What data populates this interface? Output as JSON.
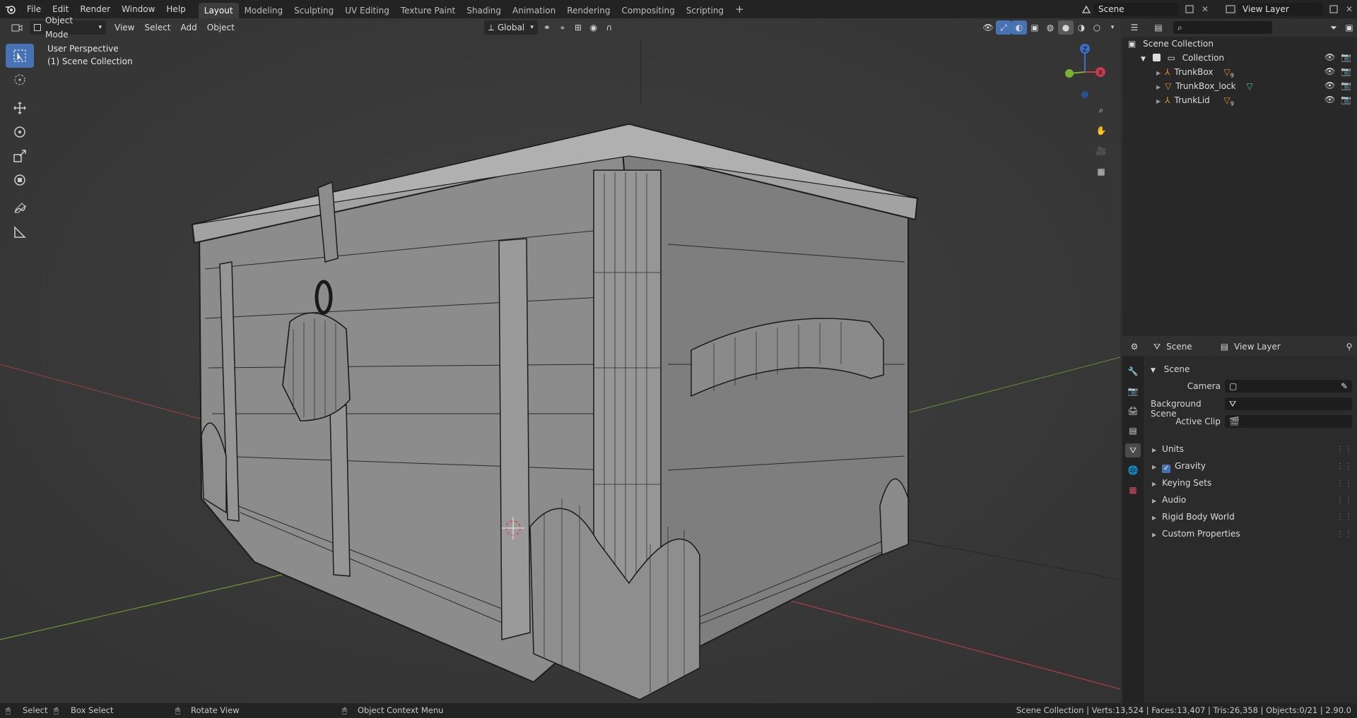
{
  "topbar": {
    "menus": [
      "File",
      "Edit",
      "Render",
      "Window",
      "Help"
    ],
    "workspaces": [
      "Layout",
      "Modeling",
      "Sculpting",
      "UV Editing",
      "Texture Paint",
      "Shading",
      "Animation",
      "Rendering",
      "Compositing",
      "Scripting"
    ],
    "add_tab": "+",
    "scene_name": "Scene",
    "view_layer_name": "View Layer"
  },
  "viewport_header": {
    "mode": "Object Mode",
    "menus": [
      "View",
      "Select",
      "Add",
      "Object"
    ],
    "orientation": "Global"
  },
  "viewport": {
    "perspective": "User Perspective",
    "collection_info": "(1) Scene Collection",
    "gizmo": {
      "z": "Z",
      "x": "X",
      "y": "Y"
    }
  },
  "outliner": {
    "root": "Scene Collection",
    "collection": "Collection",
    "items": [
      {
        "name": "TrunkBox",
        "modifier_count": "9"
      },
      {
        "name": "TrunkBox_lock",
        "modifier_count": ""
      },
      {
        "name": "TrunkLid",
        "modifier_count": "9"
      }
    ]
  },
  "properties": {
    "header_scene": "Scene",
    "header_view_layer": "View Layer",
    "panel_title": "Scene",
    "camera_label": "Camera",
    "background_scene_label": "Background Scene",
    "active_clip_label": "Active Clip",
    "sections": [
      "Units",
      "Gravity",
      "Keying Sets",
      "Audio",
      "Rigid Body World",
      "Custom Properties"
    ],
    "gravity_checked": true
  },
  "statusbar": {
    "select": "Select",
    "box_select": "Box Select",
    "rotate_view": "Rotate View",
    "context_menu": "Object Context Menu",
    "stats": "Scene Collection | Verts:13,524 | Faces:13,407 | Tris:26,358 | Objects:0/21 | 2.90.0"
  },
  "colors": {
    "accent": "#4772b3",
    "x_axis": "#c43c4f",
    "y_axis": "#7ab232",
    "z_axis": "#3d6fc9",
    "object_orange": "#e8922a",
    "mesh_green": "#3fbf8f"
  }
}
